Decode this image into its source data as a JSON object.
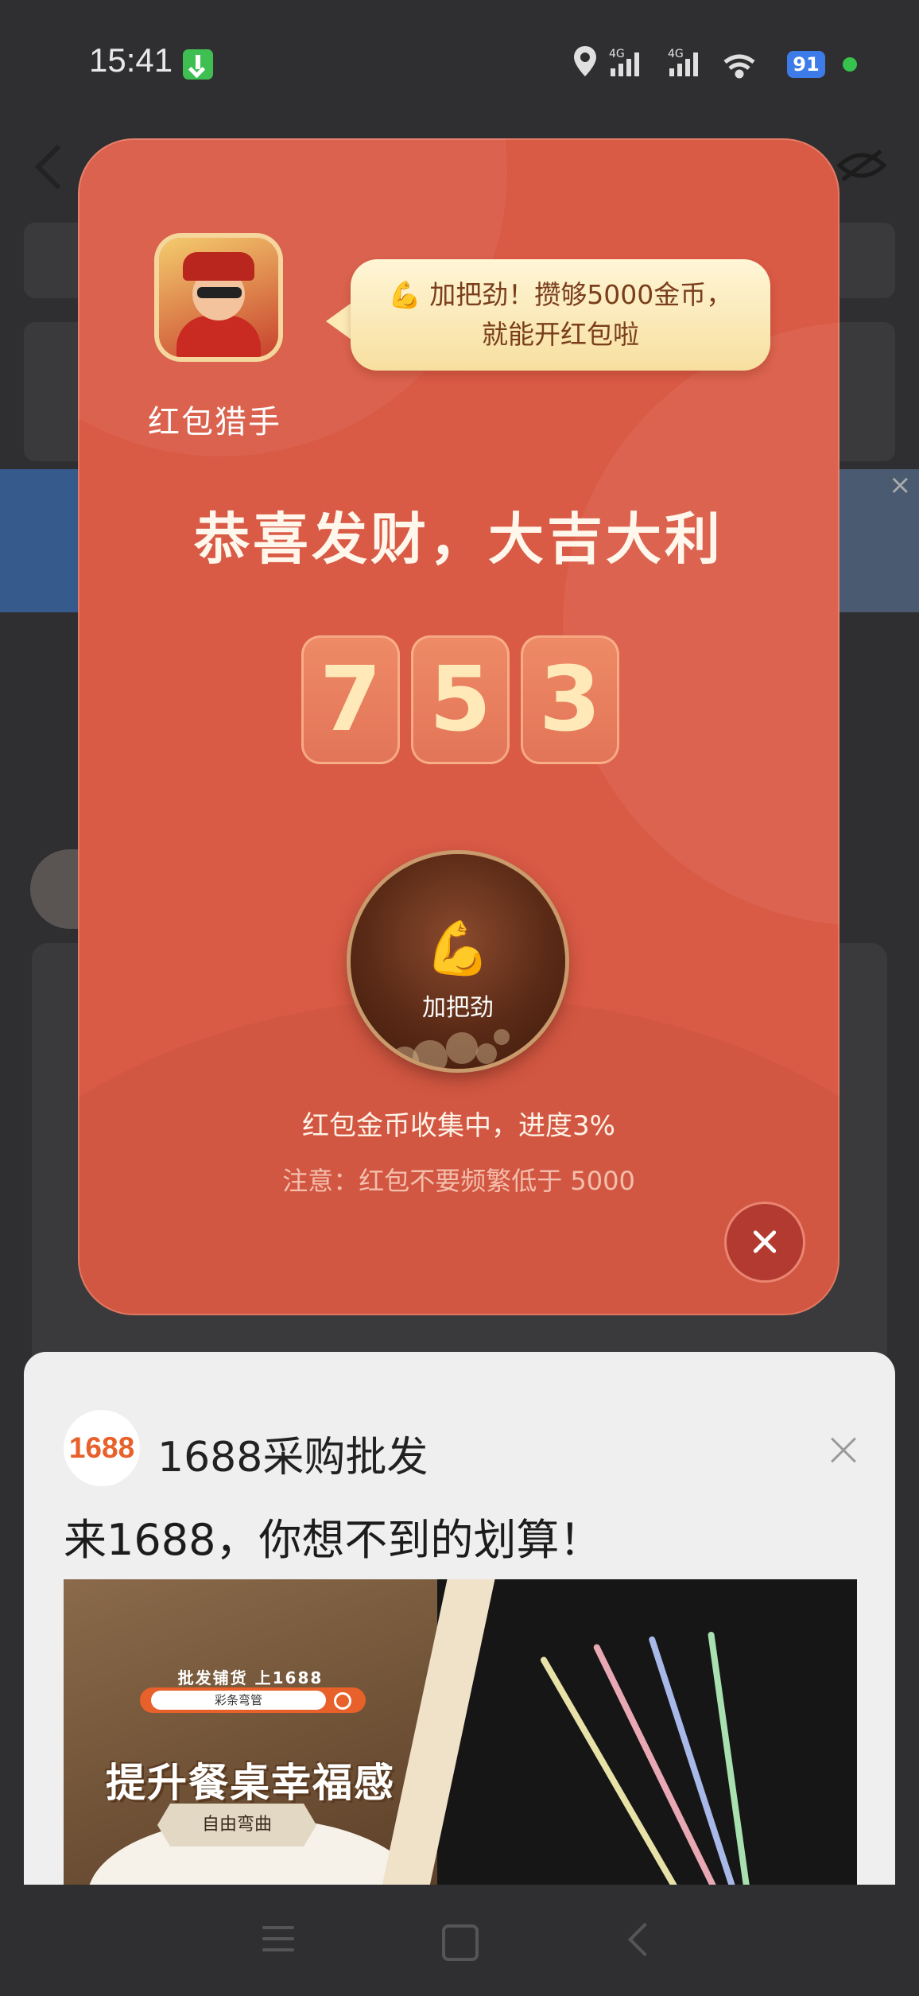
{
  "status_bar": {
    "time": "15:41",
    "battery": "91",
    "network_1": "4G",
    "network_2": "4G"
  },
  "popup": {
    "app_name": "红包猎手",
    "bubble_emoji": "💪",
    "bubble_line1": "加把劲！攒够5000金币，",
    "bubble_line2": "就能开红包啦",
    "title": "恭喜发财，大吉大利",
    "digits": [
      "7",
      "5",
      "3"
    ],
    "boost_emoji": "💪",
    "boost_label": "加把劲",
    "progress_text": "红包金币收集中，进度3%",
    "progress_value": 0.03,
    "note_text": "注意：红包不要频繁低于 5000"
  },
  "ad": {
    "logo_text": "1688",
    "brand": "1688采购批发",
    "headline": "来1688，你想不到的划算！",
    "image": {
      "sub_text": "批发铺货 上1688",
      "search_text": "彩条弯管",
      "big_text": "提升餐桌幸福感",
      "tag_text": "自由弯曲"
    }
  },
  "colors": {
    "popup_red": "#d95a45",
    "digit_gold": "#ffe9b8",
    "bubble_text": "#7a3e1c",
    "ad_orange": "#e8602a"
  }
}
